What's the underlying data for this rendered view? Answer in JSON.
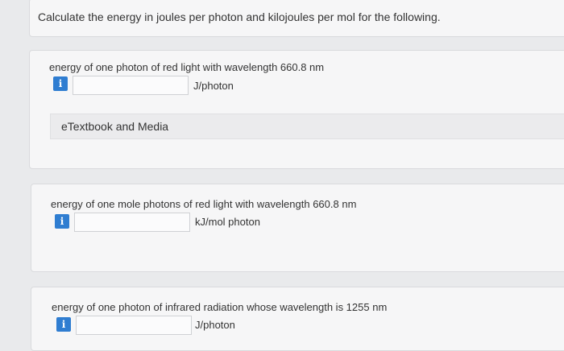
{
  "instructions": "Calculate the energy in joules per photon and kilojoules per mol for the following.",
  "questions": [
    {
      "text": "energy of one photon of red light with wavelength 660.8 nm",
      "info_label": "i",
      "answer_value": "",
      "unit": "J/photon"
    },
    {
      "text": "energy of one mole photons of red light with wavelength 660.8 nm",
      "info_label": "i",
      "answer_value": "",
      "unit": "kJ/mol photon"
    },
    {
      "text": "energy of one photon of infrared radiation whose wavelength is 1255 nm",
      "info_label": "i",
      "answer_value": "",
      "unit": "J/photon"
    }
  ],
  "media_link": "eTextbook and Media",
  "colors": {
    "info_icon": "#2f7dd1",
    "background": "#e9eaec",
    "card": "#f6f6f7"
  }
}
